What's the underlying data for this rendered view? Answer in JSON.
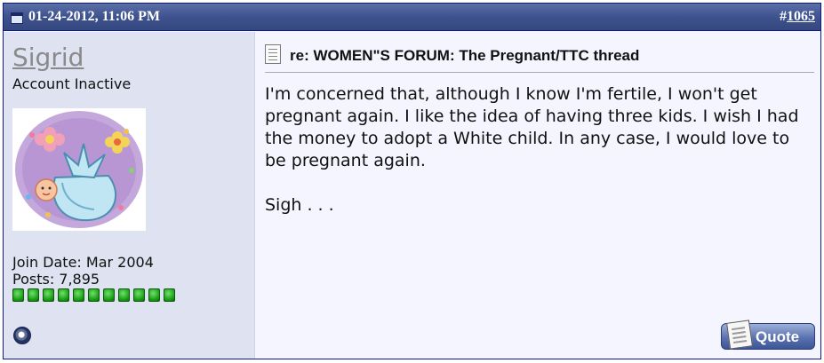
{
  "post": {
    "date": "01-24-2012, 11:06 PM",
    "number_prefix": "#",
    "number": "1065"
  },
  "user": {
    "name": "Sigrid",
    "title": "Account Inactive",
    "join_date": "Join Date: Mar 2004",
    "posts": "Posts: 7,895",
    "reputation_pips": 11,
    "online_status_icon": "offline-status-icon"
  },
  "message": {
    "title": "re: WOMEN\"S FORUM: The Pregnant/TTC thread",
    "paragraphs": [
      "I'm concerned that, although I know I'm fertile, I won't get pregnant again. I like the idea of having three kids. I wish I had the money to adopt a White child. In any case, I would love to be pregnant again.",
      "Sigh . . ."
    ]
  },
  "actions": {
    "quote_label": "Quote"
  },
  "colors": {
    "header_bg": "#3e528e",
    "userinfo_bg": "#dfe2f1",
    "message_bg": "#f5f5ff",
    "reputation_green": "#169a12"
  }
}
